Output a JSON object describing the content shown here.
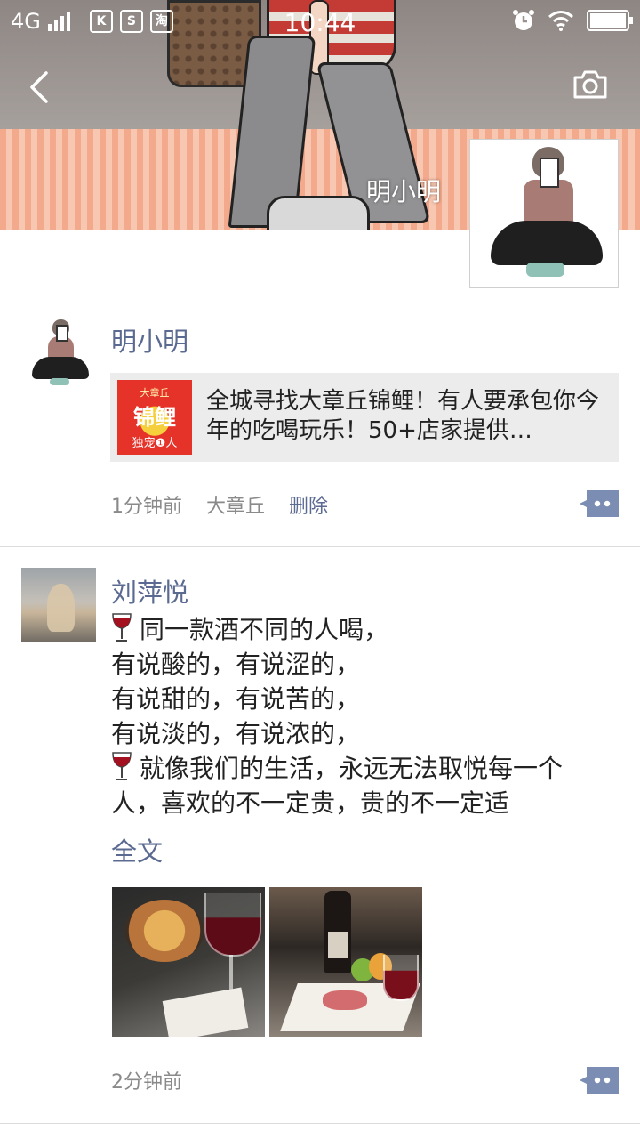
{
  "status_bar": {
    "network": "4G",
    "time": "10:44",
    "app_icons": [
      "K",
      "S",
      "淘"
    ]
  },
  "header": {
    "cover_name": "明小明"
  },
  "posts": [
    {
      "username": "明小明",
      "link": {
        "thumb_line1": "大章丘",
        "thumb_line2": "锦鲤",
        "thumb_line3": "独宠❶人",
        "text": "全城寻找大章丘锦鲤！有人要承包你今年的吃喝玩乐！50+店家提供…"
      },
      "time": "1分钟前",
      "location": "大章丘",
      "delete_label": "删除"
    },
    {
      "username": "刘萍悦",
      "lines": [
        "同一款酒不同的人喝，",
        "有说酸的，有说涩的，",
        "有说甜的，有说苦的，",
        "有说淡的，有说浓的，",
        "就像我们的生活，永远无法取悦每一个人，喜欢的不一定贵，贵的不一定适"
      ],
      "full_text_label": "全文",
      "time": "2分钟前"
    }
  ],
  "icons": {
    "back": "chevron-left-icon",
    "camera": "camera-icon",
    "comment": "comment-more-icon",
    "wine": "wine-glass-icon"
  },
  "colors": {
    "link_blue": "#5b6a91",
    "meta_gray": "#8a8a8a",
    "comment_button": "#7b8db3"
  }
}
